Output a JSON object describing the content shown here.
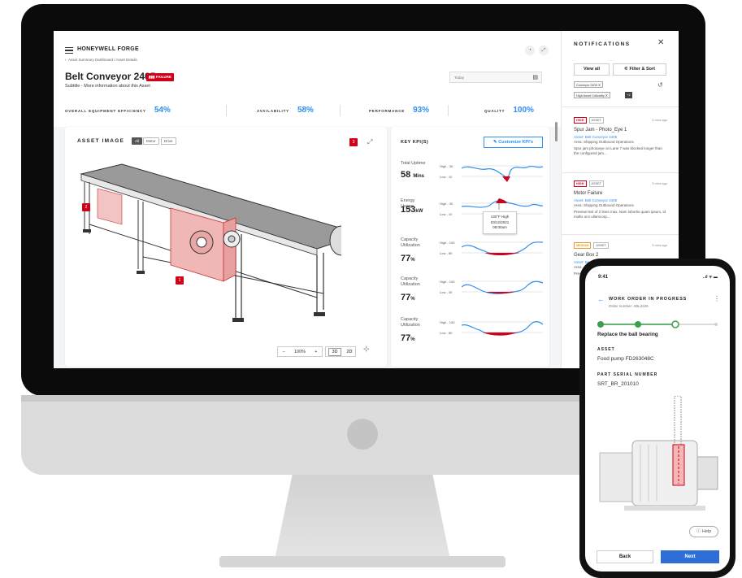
{
  "header": {
    "brand": "HONEYWELL FORGE",
    "breadcrumb": "Asset Summary Dashboard / Asset Details",
    "asset_title": "Belt Conveyor 2405",
    "status_badge": "FAILURE",
    "subtitle": "Subtitle - More information about this Asset",
    "date_placeholder": "Today"
  },
  "kpi_bar": [
    {
      "label": "OVERALL EQUIPMENT EFFICIENCY",
      "value": "54%"
    },
    {
      "label": "AVAILABILITY",
      "value": "58%"
    },
    {
      "label": "PERFORMANCE",
      "value": "93%"
    },
    {
      "label": "QUALITY",
      "value": "100%"
    }
  ],
  "asset_image": {
    "title": "ASSET IMAGE",
    "filters": [
      "All",
      "Motor",
      "Drive"
    ],
    "markers": [
      "3",
      "2",
      "1"
    ],
    "zoom": "100%",
    "zoom_minus": "−",
    "zoom_plus": "+",
    "view_modes": [
      "3D",
      "2D"
    ]
  },
  "key_kpis": {
    "title": "KEY KPI(S)",
    "customize_label": "Customize KPI's",
    "rows": [
      {
        "name": "Total Uptime",
        "value": "58",
        "unit": "Mins",
        "high": "High - 30",
        "low": "Low - 10"
      },
      {
        "name": "Energy Usage",
        "value": "153",
        "unit": "kW",
        "high": "High - 30",
        "low": "Low - 10"
      },
      {
        "name": "Capacity Utilization",
        "value": "77",
        "unit": "%",
        "high": "High - 100",
        "low": "Low - 80"
      },
      {
        "name": "Capacity Utilization",
        "value": "77",
        "unit": "%",
        "high": "High - 100",
        "low": "Low - 30"
      },
      {
        "name": "Capacity Utilization",
        "value": "77",
        "unit": "%",
        "high": "High - 100",
        "low": "Low - 80"
      }
    ],
    "tooltip": {
      "line1": "130°F High",
      "line2": "03/12/2021",
      "line3": "08:00am"
    }
  },
  "notifications": {
    "title": "NOTIFICATIONS",
    "view_all": "View all",
    "filter_sort": "Filter & Sort",
    "tags": [
      "Conveyor 2405",
      "High Asset Criticality"
    ],
    "more_tags": "+2",
    "items": [
      {
        "severity": "HIGH",
        "category": "ASSET",
        "time": "5 mins ago",
        "title": "Spur Jam - Photo_Eye 1",
        "asset": "Asset: Belt Conveyor 2405",
        "area": "Area: Shipping Outbound Operations",
        "desc": "Spur jam photoeye on Lane 7 was blocked longer than the configured jam..."
      },
      {
        "severity": "HIGH",
        "category": "ASSET",
        "time": "5 mins ago",
        "title": "Motor Failure",
        "asset": "Asset: Belt Conveyor 2405",
        "area": "Area: Shipping Outbound Operations",
        "desc": "Preview text of 2 lines max. Nam lobortis quam ipsum, id mollis orci ullamcorp..."
      },
      {
        "severity": "MEDIUM",
        "category": "ASSET",
        "time": "5 mins ago",
        "title": "Gear Box 2",
        "asset": "Asset: Be",
        "area": "Area",
        "desc": "Prev"
      }
    ]
  },
  "mobile": {
    "time": "9:41",
    "status": "..ıl ᯤ ▬",
    "heading": "WORK ORDER IN PROGRESS",
    "order_number": "Order number: ABL2345",
    "current_step": "Replace the ball bearing",
    "asset_label": "ASSET",
    "asset_value": "Food pump FD263048C",
    "serial_label": "PART SERIAL NUMBER",
    "serial_value": "SRT_BR_201010",
    "help": "Help",
    "back": "Back",
    "next": "Next"
  },
  "colors": {
    "accent": "#2d8ff0",
    "alert": "#d0021b",
    "primary_button": "#2d6fd6"
  }
}
